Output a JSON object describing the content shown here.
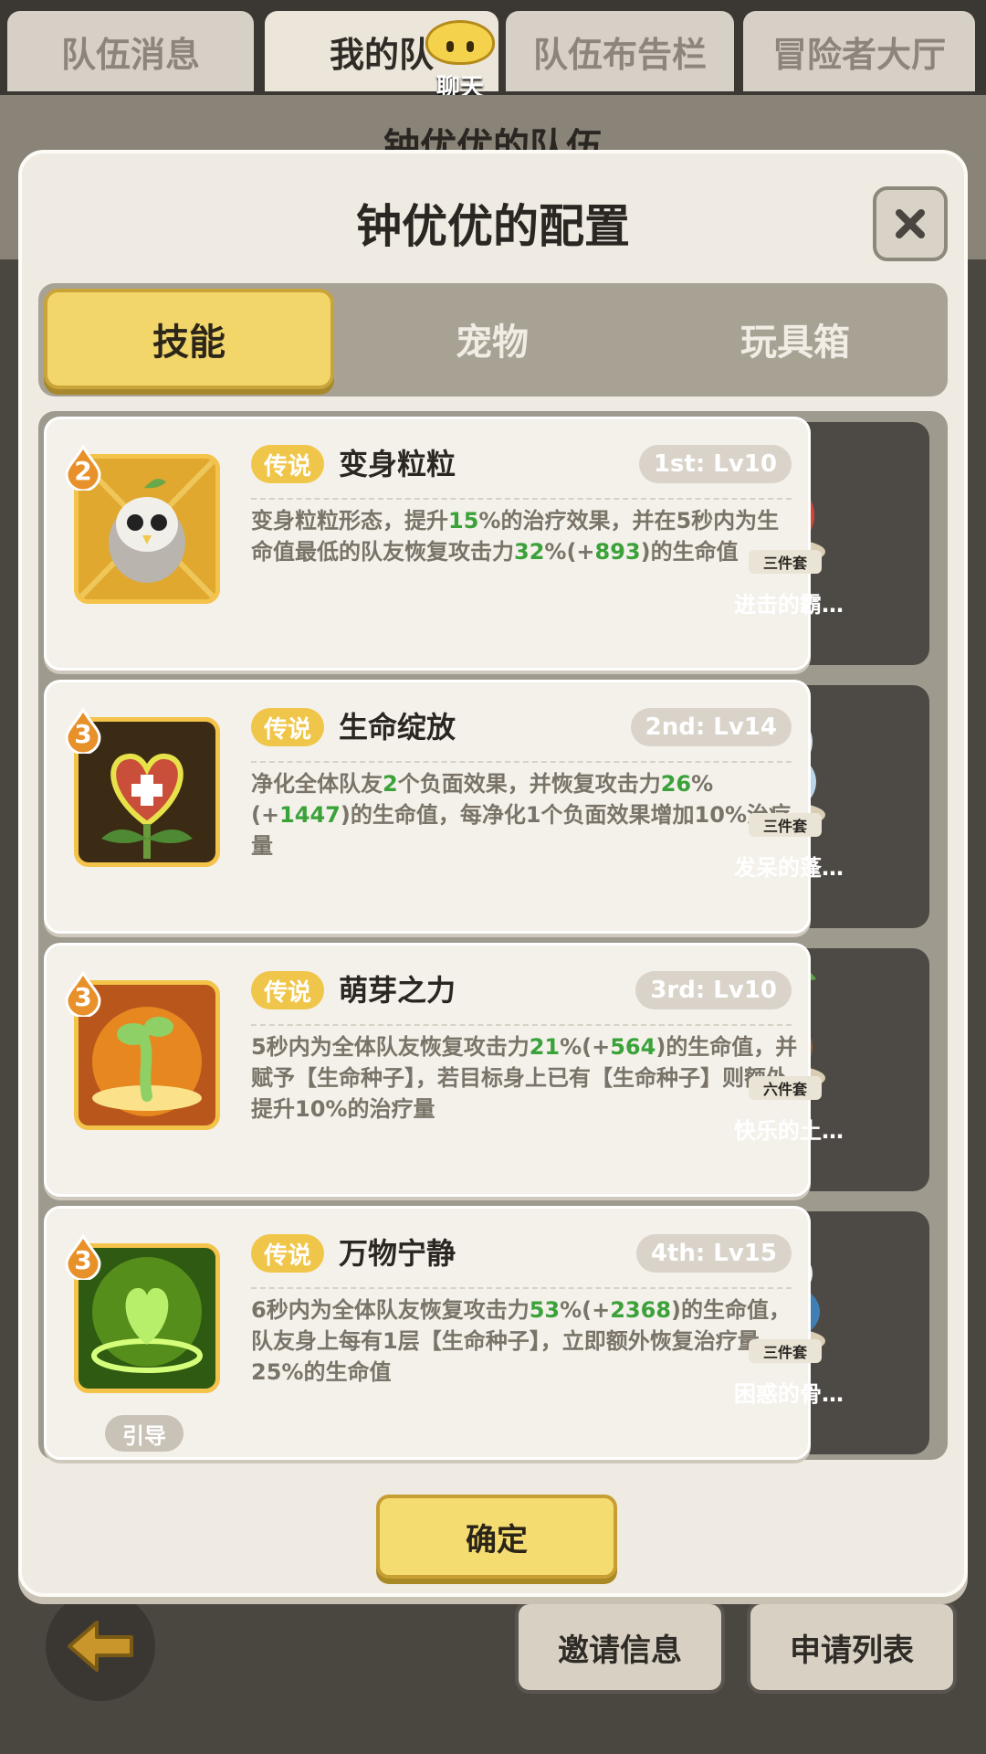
{
  "top_tabs": [
    {
      "label": "队伍消息",
      "active": false
    },
    {
      "label": "我的队",
      "active": true
    },
    {
      "label": "队伍布告栏",
      "active": false
    },
    {
      "label": "冒险者大厅",
      "active": false
    }
  ],
  "chat": {
    "label": "聊天"
  },
  "background_title": "钟优优的队伍",
  "modal": {
    "title": "钟优优的配置",
    "close_icon": "close-x",
    "tabs": [
      {
        "label": "技能",
        "active": true
      },
      {
        "label": "宠物",
        "active": false
      },
      {
        "label": "玩具箱",
        "active": false
      }
    ],
    "confirm_label": "确定"
  },
  "skills": [
    {
      "tier": "2",
      "rarity": "传说",
      "name": "变身粒粒",
      "level": "1st: Lv10",
      "desc_parts": [
        "变身粒粒形态，提升",
        "15",
        "%的治疗效果，并在5秒内为生命值最低的队友恢复攻击力",
        "32",
        "%(+",
        "893",
        ")的生命值"
      ],
      "channel": "",
      "pet_badge": "三件套",
      "pet_name": "进击的霸…",
      "pet_icon": "red-dino-pet-icon"
    },
    {
      "tier": "3",
      "rarity": "传说",
      "name": "生命绽放",
      "level": "2nd: Lv14",
      "desc_parts": [
        "净化全体队友",
        "2",
        "个负面效果，并恢复攻击力",
        "26",
        "%(+",
        "1447",
        ")的生命值，每净化1个负面效果增加10%治疗量"
      ],
      "channel": "",
      "pet_badge": "三件套",
      "pet_name": "发呆的蓬…",
      "pet_icon": "sheep-pet-icon"
    },
    {
      "tier": "3",
      "rarity": "传说",
      "name": "萌芽之力",
      "level": "3rd: Lv10",
      "desc_parts": [
        "5秒内为全体队友恢复攻击力",
        "21",
        "%(+",
        "564",
        ")的生命值，并赋予【生命种子】，若目标身上已有【生命种子】则额外提升10%的治疗量"
      ],
      "channel": "",
      "pet_badge": "六件套",
      "pet_name": "快乐的土…",
      "pet_icon": "sprout-bear-pet-icon"
    },
    {
      "tier": "3",
      "rarity": "传说",
      "name": "万物宁静",
      "level": "4th: Lv15",
      "desc_parts": [
        "6秒内为全体队友恢复攻击力",
        "53",
        "%(+",
        "2368",
        ")的生命值，队友身上每有1层【生命种子】，立即额外恢复治疗量25%的生命值"
      ],
      "channel": "引导",
      "pet_badge": "三件套",
      "pet_name": "困惑的骨…",
      "pet_icon": "bone-dino-pet-icon"
    }
  ],
  "bottom_buttons": [
    {
      "label": "邀请信息"
    },
    {
      "label": "申请列表"
    }
  ],
  "colors": {
    "accent_yellow": "#f2d66a",
    "highlight_green": "#3ba23a",
    "rarity_gold": "#f0c64a"
  }
}
